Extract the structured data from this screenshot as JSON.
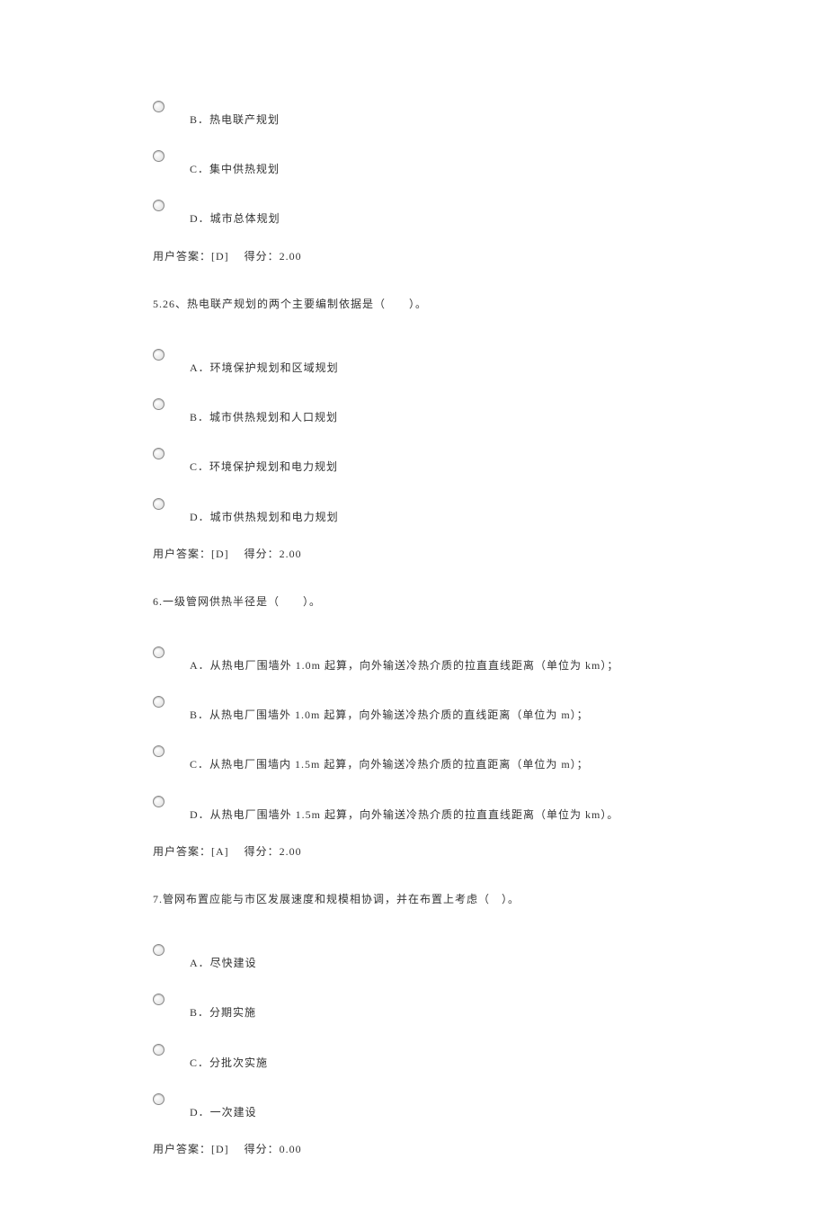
{
  "quiz": {
    "partial_q4": {
      "options": [
        {
          "label": "B．热电联产规划"
        },
        {
          "label": "C．集中供热规划"
        },
        {
          "label": "D．城市总体规划"
        }
      ],
      "answer": "用户答案：[D]　 得分：2.00"
    },
    "q5": {
      "question": "5.26、热电联产规划的两个主要编制依据是（　　）。",
      "options": [
        {
          "label": "A．环境保护规划和区域规划"
        },
        {
          "label": "B．城市供热规划和人口规划"
        },
        {
          "label": "C．环境保护规划和电力规划"
        },
        {
          "label": "D．城市供热规划和电力规划"
        }
      ],
      "answer": "用户答案：[D]　 得分：2.00"
    },
    "q6": {
      "question": "6.一级管网供热半径是（　　）。",
      "options": [
        {
          "label": "A．从热电厂围墙外 1.0m 起算，向外输送冷热介质的拉直直线距离（单位为 km）；"
        },
        {
          "label": "B．从热电厂围墙外 1.0m 起算，向外输送冷热介质的直线距离（单位为 m）；"
        },
        {
          "label": "C．从热电厂围墙内 1.5m 起算，向外输送冷热介质的拉直距离（单位为 m）；"
        },
        {
          "label": "D．从热电厂围墙外 1.5m 起算，向外输送冷热介质的拉直直线距离（单位为 km）。"
        }
      ],
      "answer": "用户答案：[A]　 得分：2.00"
    },
    "q7": {
      "question": "7.管网布置应能与市区发展速度和规模相协调，并在布置上考虑（　）。",
      "options": [
        {
          "label": "A．尽快建设"
        },
        {
          "label": "B．分期实施"
        },
        {
          "label": "C．分批次实施"
        },
        {
          "label": "D．一次建设"
        }
      ],
      "answer": "用户答案：[D]　 得分：0.00"
    }
  },
  "footer": ""
}
